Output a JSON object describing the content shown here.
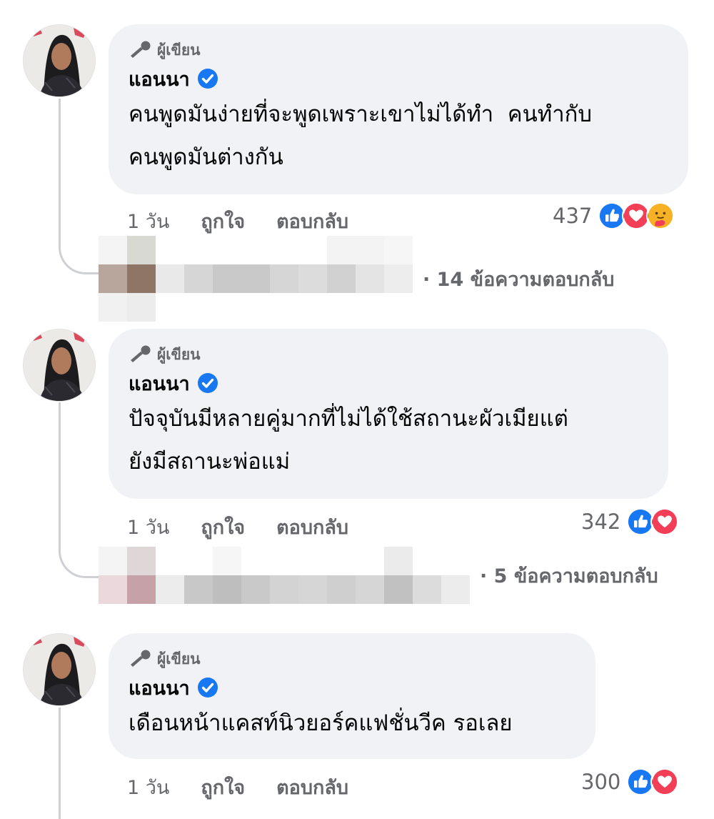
{
  "comments": [
    {
      "author_badge": "ผู้เขียน",
      "name": "แอนนา",
      "text": "คนพูดมันง่ายที่จะพูดเพราะเขาไม่ได้ทำ  คนทำกับ\nคนพูดมันต่างกัน",
      "time": "1 วัน",
      "like_label": "ถูกใจ",
      "reply_label": "ตอบกลับ",
      "reaction_count": "437",
      "reactions": [
        "like-icon",
        "love-icon",
        "care-icon"
      ],
      "replies_label": "· 14 ข้อความตอบกลับ"
    },
    {
      "author_badge": "ผู้เขียน",
      "name": "แอนนา",
      "text": "ปัจจุบันมีหลายคู่มากที่ไม่ได้ใช้สถานะผัวเมียแต่\nยังมีสถานะพ่อแม่",
      "time": "1 วัน",
      "like_label": "ถูกใจ",
      "reply_label": "ตอบกลับ",
      "reaction_count": "342",
      "reactions": [
        "like-icon",
        "love-icon"
      ],
      "replies_label": "· 5 ข้อความตอบกลับ"
    },
    {
      "author_badge": "ผู้เขียน",
      "name": "แอนนา",
      "text": "เดือนหน้าแคสท์นิวยอร์คแฟชั่นวีค รอเลย",
      "time": "1 วัน",
      "like_label": "ถูกใจ",
      "reply_label": "ตอบกลับ",
      "reaction_count": "300",
      "reactions": [
        "like-icon",
        "love-icon"
      ]
    }
  ],
  "colors": {
    "bubble": "#f0f2f5",
    "secondary_text": "#65676b",
    "like_blue": "#1877f2",
    "love_red": "#f33e58",
    "verified_blue": "#1877f2"
  }
}
